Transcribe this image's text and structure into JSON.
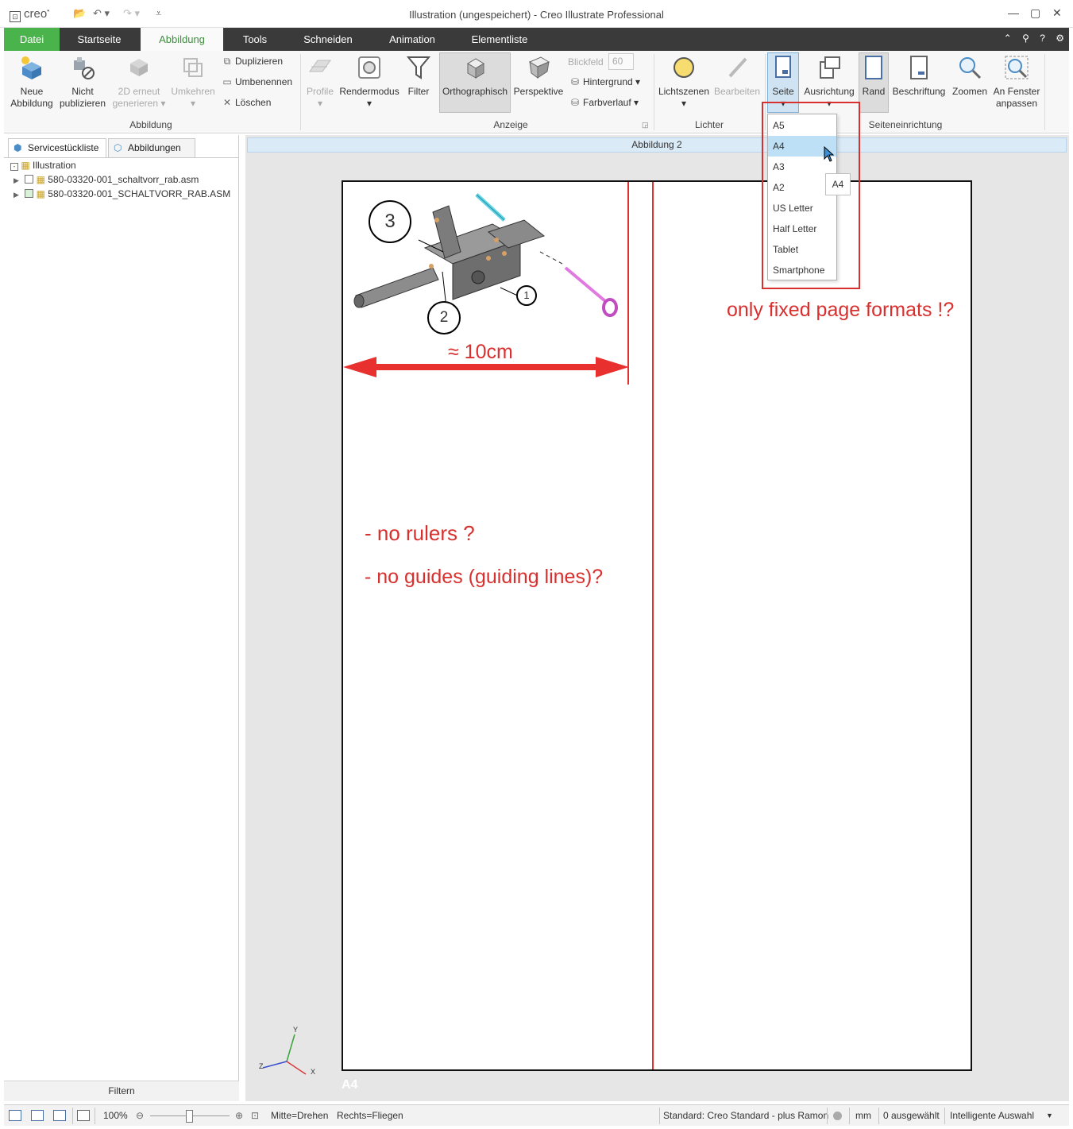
{
  "titlebar": {
    "logo": "creo",
    "title": "Illustration (ungespeichert) - Creo Illustrate Professional"
  },
  "tabs": [
    "Datei",
    "Startseite",
    "Abbildung",
    "Tools",
    "Schneiden",
    "Animation",
    "Elementliste"
  ],
  "active_tab": "Abbildung",
  "ribbon": {
    "abbildung": {
      "neue": [
        "Neue",
        "Abbildung"
      ],
      "nicht": [
        "Nicht",
        "publizieren"
      ],
      "erneut": [
        "2D erneut",
        "generieren"
      ],
      "umkehren": "Umkehren",
      "duplizieren": "Duplizieren",
      "umbenennen": "Umbenennen",
      "loeschen": "Löschen",
      "group": "Abbildung"
    },
    "anzeige": {
      "profile": "Profile",
      "rendermodus": "Rendermodus",
      "filter": "Filter",
      "ortho": "Orthographisch",
      "perspektive": "Perspektive",
      "blickfeld": "Blickfeld",
      "blickfeld_value": "60",
      "hintergrund": "Hintergrund",
      "farbverlauf": "Farbverlauf",
      "group": "Anzeige"
    },
    "lichter": {
      "lichtszenen": "Lichtszenen",
      "bearbeiten": "Bearbeiten",
      "group": "Lichter"
    },
    "seite": {
      "seite": "Seite",
      "ausrichtung": "Ausrichtung",
      "rand": "Rand",
      "beschriftung": "Beschriftung",
      "zoomen": "Zoomen",
      "fenster": [
        "An Fenster",
        "anpassen"
      ],
      "group": "Seiteneinrichtung"
    }
  },
  "leftpanel": {
    "tabs": [
      "Servicestückliste",
      "Abbildungen"
    ],
    "tree": [
      "Illustration",
      "580-03320-001_schaltvorr_rab.asm",
      "580-03320-001_SCHALTVORR_RAB.ASM"
    ],
    "filter": "Filtern"
  },
  "canvas": {
    "header": "Abbildung 2",
    "page_label": "A4",
    "callouts": [
      "3",
      "2",
      "1"
    ],
    "axes": [
      "Y",
      "Z",
      "X"
    ]
  },
  "annotations": {
    "width": "≈ 10cm",
    "rulers": "- no rulers ?",
    "guides": "- no guides (guiding lines)?",
    "formats": "only fixed page formats !?"
  },
  "dropdown": {
    "items": [
      "A5",
      "A4",
      "A3",
      "A2",
      "US Letter",
      "Half Letter",
      "Tablet",
      "Smartphone"
    ],
    "highlighted": "A4",
    "tooltip": "A4"
  },
  "statusbar": {
    "zoom": "100%",
    "mouse_left": "Mitte=Drehen",
    "mouse_right": "Rechts=Fliegen",
    "standard": "Standard: Creo Standard - plus Ramon",
    "unit": "mm",
    "selected": "0 ausgewählt",
    "selection_mode": "Intelligente Auswahl"
  },
  "colors": {
    "accent_green": "#4bb34b",
    "annotation_red": "#d8302f",
    "highlight_blue": "#bde0f7"
  }
}
